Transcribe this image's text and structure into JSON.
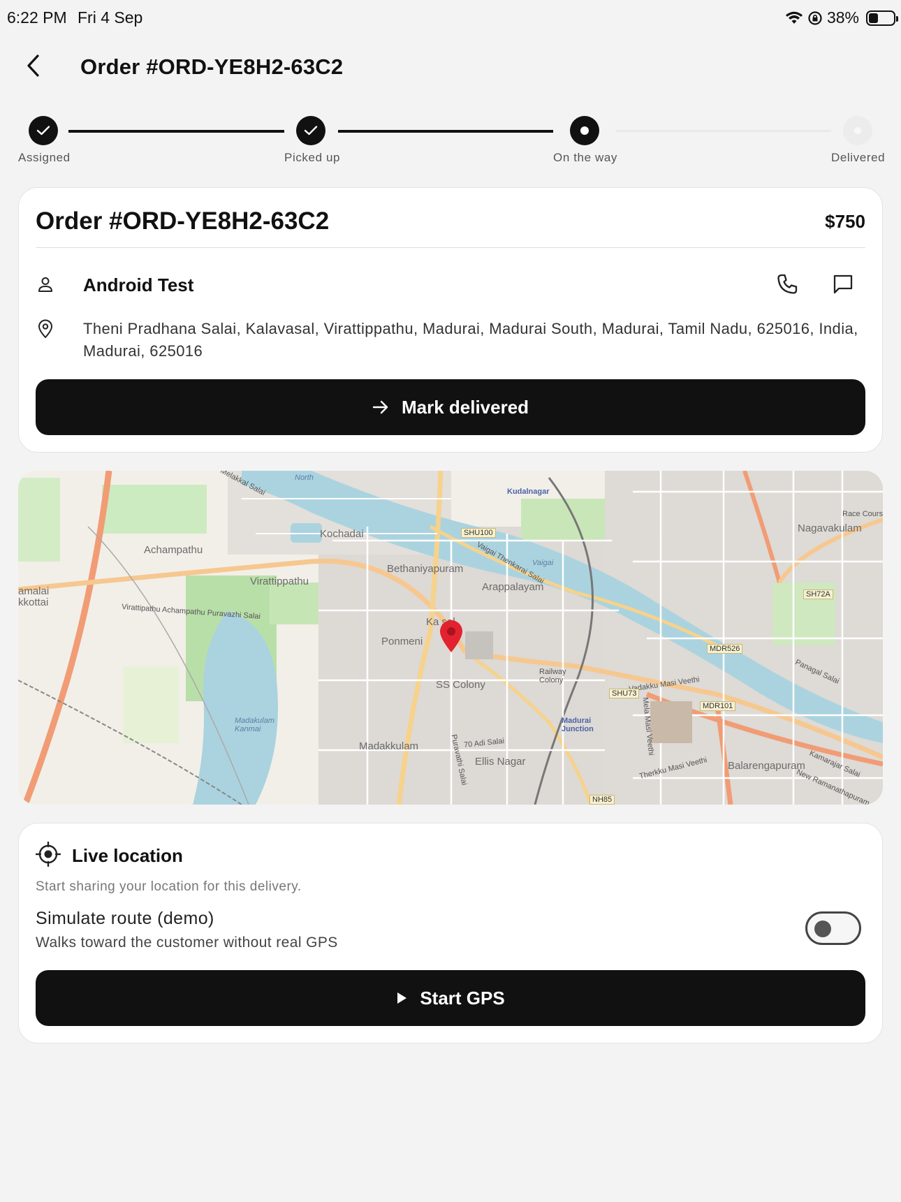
{
  "status_bar": {
    "time": "6:22 PM",
    "date": "Fri 4 Sep",
    "battery": "38%",
    "battery_level": 0.38
  },
  "header": {
    "title": "Order #ORD-YE8H2-63C2"
  },
  "stepper": {
    "steps": [
      {
        "label": "Assigned",
        "state": "done"
      },
      {
        "label": "Picked up",
        "state": "done"
      },
      {
        "label": "On the way",
        "state": "current"
      },
      {
        "label": "Delivered",
        "state": "pending"
      }
    ]
  },
  "order": {
    "title": "Order #ORD-YE8H2-63C2",
    "price": "$750",
    "customer_name": "Android Test",
    "address": "Theni Pradhana Salai, Kalavasal, Virattippathu, Madurai, Madurai South, Madurai, Tamil Nadu, 625016, India, Madurai, 625016",
    "action_label": "Mark delivered"
  },
  "map": {
    "labels": {
      "kudalnagar": "Kudalnagar",
      "kochadai": "Kochadai",
      "achampathu": "Achampathu",
      "bethaniyapuram": "Bethaniyapuram",
      "arappalayam": "Arappalayam",
      "virattippathu": "Virattippathu",
      "ponmeni": "Ponmeni",
      "kalavasal": "Ka  sal",
      "ss_colony": "SS Colony",
      "madakkulam": "Madakkulam",
      "ellis_nagar": "Ellis Nagar",
      "nagavakulam": "Nagavakulam",
      "balarengapuram": "Balarengapuram",
      "madurai_junction": "Madurai Junction",
      "madakulam_kanmai": "Madakulam Kanmai",
      "railway_colony": "Railway Colony",
      "vaigai": "Vaigai",
      "race_course": "Race Course",
      "amalai": "amalai",
      "kkottai": "kkottai",
      "vaigai_north": "North",
      "melakkal_salai": "Melakkal Salai",
      "virattipathu_road": "Virattipathu Achampathu Puravazhi Salai",
      "vaigai_thenkarai": "Vaigai Thenkarai Salai",
      "panagal_salai": "Panagal Salai",
      "vadakku_masi": "Vadakku Masi Veethi",
      "mela_masi": "Mela Masi Veethi",
      "therkku_masi": "Therkku Masi Veethi",
      "kamarajar_salai": "Kamarajar Salai",
      "adi_salai": "70 Adi Salai",
      "purathi_salai": "Puravathi Salai",
      "new_ramanathapuram": "New Ramanathapuram"
    },
    "shields": [
      "SHU100",
      "SH72A",
      "MDR526",
      "SHU73",
      "MDR101",
      "NH85"
    ],
    "marker_color": "#e2232f"
  },
  "live_location": {
    "title": "Live location",
    "subtitle": "Start sharing your location for this delivery.",
    "simulate_title": "Simulate route (demo)",
    "simulate_desc": "Walks toward the customer without real GPS",
    "simulate_enabled": false,
    "action_label": "Start GPS"
  }
}
